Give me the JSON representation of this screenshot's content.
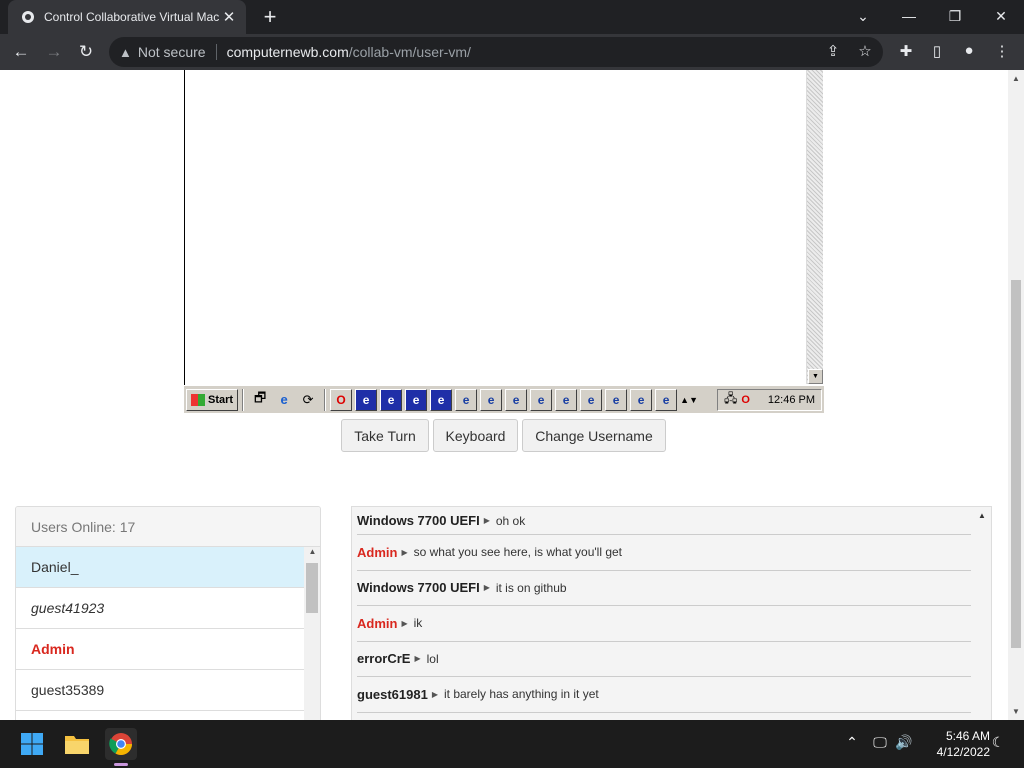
{
  "browser": {
    "tab_title": "Control Collaborative Virtual Machines",
    "security_label": "Not secure",
    "url_host": "computernewb.com",
    "url_path": "/collab-vm/user-vm/"
  },
  "vm": {
    "start_label": "Start",
    "tray_time": "12:46 PM"
  },
  "controls": {
    "take_turn": "Take Turn",
    "keyboard": "Keyboard",
    "change_username": "Change Username"
  },
  "users": {
    "header": "Users Online: 17",
    "list": [
      {
        "name": "Daniel_",
        "kind": "me"
      },
      {
        "name": "guest41923",
        "kind": "guest"
      },
      {
        "name": "Admin",
        "kind": "admin"
      },
      {
        "name": "guest35389",
        "kind": "user"
      }
    ]
  },
  "chat": {
    "messages": [
      {
        "user": "Windows 7700 UEFI",
        "text": "oh ok",
        "admin": false
      },
      {
        "user": "Admin",
        "text": "so what you see here, is what you'll get",
        "admin": true
      },
      {
        "user": "Windows 7700 UEFI",
        "text": "it is on github",
        "admin": false
      },
      {
        "user": "Admin",
        "text": "ik",
        "admin": true
      },
      {
        "user": "errorCrE",
        "text": "lol",
        "admin": false
      },
      {
        "user": "guest61981",
        "text": "it barely has anything in it yet",
        "admin": false
      }
    ]
  },
  "taskbar": {
    "time": "5:46 AM",
    "date": "4/12/2022"
  },
  "colors": {
    "admin": "#d9281f",
    "selected_user": "#d9f1fb"
  }
}
